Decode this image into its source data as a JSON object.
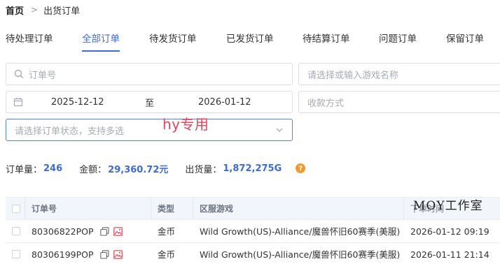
{
  "breadcrumb": {
    "home": "首页",
    "separator": ">",
    "current": "出货订单"
  },
  "tabs": [
    {
      "label": "待处理订单",
      "active": false
    },
    {
      "label": "全部订单",
      "active": true
    },
    {
      "label": "待发货订单",
      "active": false
    },
    {
      "label": "已发货订单",
      "active": false
    },
    {
      "label": "待结算订单",
      "active": false
    },
    {
      "label": "问题订单",
      "active": false
    },
    {
      "label": "保留订单",
      "active": false
    }
  ],
  "filters": {
    "order_no_placeholder": "订单号",
    "game_placeholder": "请选择或输入游戏名称",
    "date_start": "2025-12-12",
    "date_sep": "至",
    "date_end": "2026-01-12",
    "payment_placeholder": "收款方式",
    "status_placeholder": "请选择订单状态，支持多选"
  },
  "overlay_note": "hy专用",
  "stats": {
    "order_count_label": "订单量：",
    "order_count": "246",
    "amount_label": "金额：",
    "amount": "29,360.72元",
    "volume_label": "出货量：",
    "volume": "1,872,275G",
    "help_icon": "?"
  },
  "table": {
    "headers": {
      "order_no": "订单号",
      "type": "类型",
      "game": "区服游戏",
      "time": "下单时间"
    },
    "rows": [
      {
        "order_no": "80306822POP",
        "type": "金币",
        "game": "Wild Growth(US)-Alliance/魔兽怀旧60赛季(美服)",
        "time": "2026-01-12 09:19"
      },
      {
        "order_no": "80306199POP",
        "type": "金币",
        "game": "Wild Growth(US)-Alliance/魔兽怀旧60赛季(美服)",
        "time": "2026-01-11 21:14"
      }
    ]
  },
  "watermark": "MOY工作室",
  "colors": {
    "accent": "#3d6bd9",
    "note_red": "#e2465c",
    "help_orange": "#f29a2e",
    "icon_red": "#e0414f"
  },
  "icons": [
    "search-icon",
    "calendar-icon",
    "chevron-down-icon",
    "copy-icon",
    "image-icon",
    "help-icon"
  ]
}
